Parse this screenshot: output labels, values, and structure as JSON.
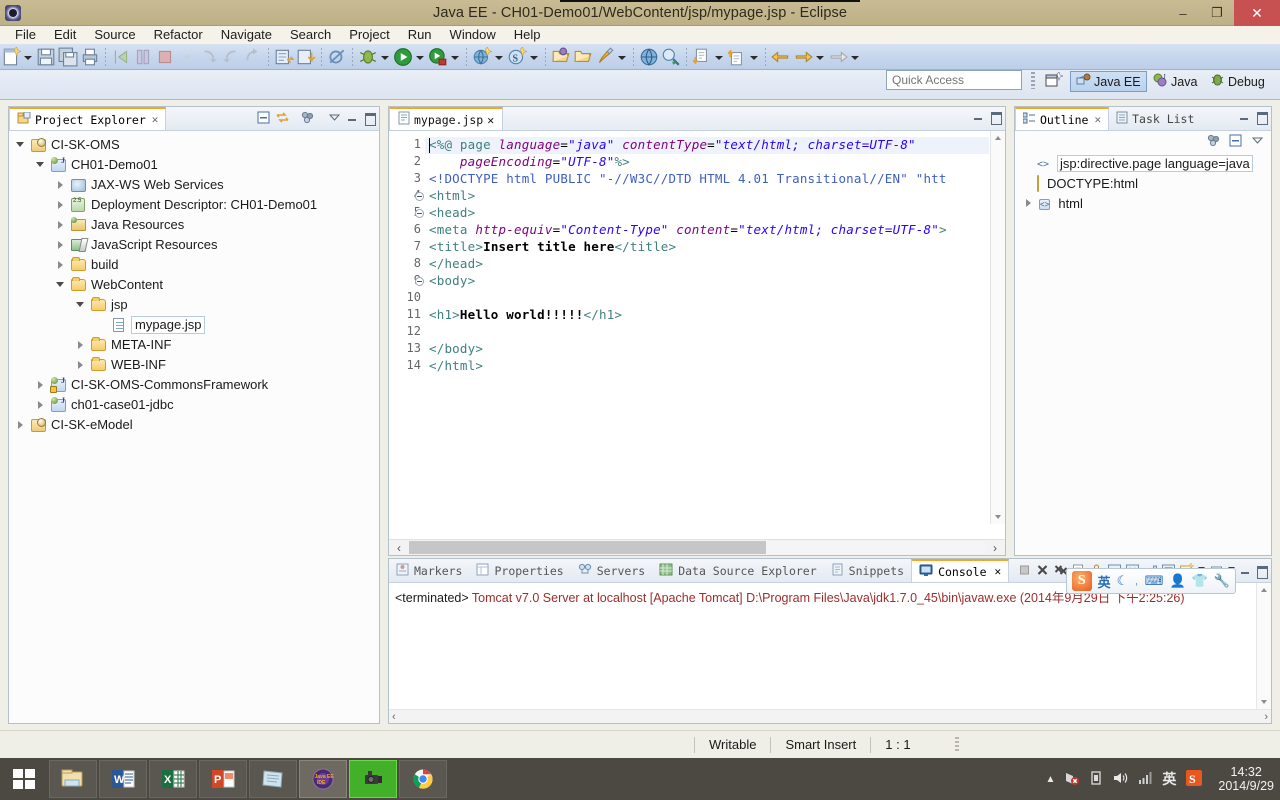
{
  "window": {
    "title": "Java EE - CH01-Demo01/WebContent/jsp/mypage.jsp - Eclipse",
    "minimize": "–",
    "maximize": "❐",
    "close": "✕"
  },
  "menubar": {
    "items": [
      "File",
      "Edit",
      "Source",
      "Refactor",
      "Navigate",
      "Search",
      "Project",
      "Run",
      "Window",
      "Help"
    ]
  },
  "toolbar": {
    "groups": [
      {
        "icons": [
          "new-wizard-icon",
          "new-dropdown-arrow",
          "save-icon",
          "save-all-icon",
          "print-icon"
        ]
      },
      {
        "icons": [
          "resume-icon",
          "suspend-icon",
          "terminate-icon",
          "step-icon",
          "step-into-icon",
          "step-over-icon",
          "step-return-icon"
        ]
      },
      {
        "icons": [
          "new-jsp-icon",
          "import-icon"
        ]
      },
      {
        "icons": [
          "skip-breakpoints-icon"
        ]
      },
      {
        "icons": [
          "debug-icon",
          "debug-dropdown-arrow",
          "run-icon",
          "run-dropdown-arrow",
          "run-external-icon",
          "external-dropdown-arrow"
        ]
      },
      {
        "icons": [
          "new-server-icon",
          "server-dropdown-arrow",
          "new-session-icon",
          "session-dropdown-arrow"
        ]
      },
      {
        "icons": [
          "open-type-icon",
          "open-task-icon",
          "brush-icon",
          "brush-dropdown-arrow"
        ]
      },
      {
        "icons": [
          "web-browser-icon",
          "search-icon"
        ]
      },
      {
        "icons": [
          "next-annotation-icon",
          "next-dropdown-arrow",
          "previous-annotation-icon",
          "previous-dropdown-arrow"
        ]
      },
      {
        "icons": [
          "back-icon",
          "forward-icon",
          "forward-dropdown-arrow",
          "last-edit-icon",
          "last-dropdown-arrow"
        ]
      }
    ]
  },
  "quick_access": {
    "placeholder": "Quick Access",
    "value": ""
  },
  "perspectives": {
    "open_perspective_icon": "open-perspective-icon",
    "items": [
      {
        "label": "Java EE",
        "icon": "java-ee-icon",
        "active": true
      },
      {
        "label": "Java",
        "icon": "java-icon",
        "active": false
      },
      {
        "label": "Debug",
        "icon": "debug-perspective-icon",
        "active": false
      }
    ]
  },
  "project_explorer": {
    "tab_label": "Project Explorer",
    "tab_close": "✕",
    "toolbar_icons": [
      "collapse-all-icon",
      "link-with-editor-icon",
      "view-menu-icon",
      "view-dropdown-icon",
      "minimize-icon",
      "maximize-icon"
    ],
    "tree": [
      {
        "label": "CI-SK-OMS",
        "depth": 0,
        "twist": "open",
        "icon": "project-icon",
        "selected": false
      },
      {
        "label": "CH01-Demo01",
        "depth": 1,
        "twist": "open",
        "icon": "web-project-icon",
        "selected": false
      },
      {
        "label": "JAX-WS Web Services",
        "depth": 2,
        "twist": "closed",
        "icon": "jax-ws-icon",
        "selected": false
      },
      {
        "label": "Deployment Descriptor: CH01-Demo01",
        "depth": 2,
        "twist": "closed",
        "icon": "deployment-descriptor-icon",
        "selected": false
      },
      {
        "label": "Java Resources",
        "depth": 2,
        "twist": "closed",
        "icon": "java-resources-icon",
        "selected": false
      },
      {
        "label": "JavaScript Resources",
        "depth": 2,
        "twist": "closed",
        "icon": "javascript-resources-icon",
        "selected": false
      },
      {
        "label": "build",
        "depth": 2,
        "twist": "closed",
        "icon": "folder-icon",
        "selected": false
      },
      {
        "label": "WebContent",
        "depth": 2,
        "twist": "open",
        "icon": "folder-icon",
        "selected": false
      },
      {
        "label": "jsp",
        "depth": 3,
        "twist": "open",
        "icon": "folder-icon",
        "selected": false
      },
      {
        "label": "mypage.jsp",
        "depth": 4,
        "twist": "none",
        "icon": "jsp-file-icon",
        "selected": true
      },
      {
        "label": "META-INF",
        "depth": 3,
        "twist": "closed",
        "icon": "folder-icon",
        "selected": false
      },
      {
        "label": "WEB-INF",
        "depth": 3,
        "twist": "closed",
        "icon": "folder-icon",
        "selected": false
      },
      {
        "label": "CI-SK-OMS-CommonsFramework",
        "depth": 1,
        "twist": "closed",
        "icon": "web-project-warning-icon",
        "selected": false
      },
      {
        "label": "ch01-case01-jdbc",
        "depth": 1,
        "twist": "closed",
        "icon": "web-project-icon",
        "selected": false
      },
      {
        "label": "CI-SK-eModel",
        "depth": 0,
        "twist": "closed",
        "icon": "project-icon",
        "selected": false
      }
    ]
  },
  "editor": {
    "tab_label": "mypage.jsp",
    "tab_icon": "jsp-file-icon",
    "tab_close": "✕",
    "minimize_icon": "minimize-icon",
    "maximize_icon": "maximize-icon",
    "cursor_line": 1,
    "lines": [
      {
        "n": 1,
        "fold": false,
        "highlight": true,
        "segments": [
          {
            "t": "<%@ ",
            "c": "dir"
          },
          {
            "t": "page ",
            "c": "dir"
          },
          {
            "t": "language",
            "c": "attr"
          },
          {
            "t": "=",
            "c": "punct"
          },
          {
            "t": "\"java\"",
            "c": "val"
          },
          {
            "t": " ",
            "c": "punct"
          },
          {
            "t": "contentType",
            "c": "attr"
          },
          {
            "t": "=",
            "c": "punct"
          },
          {
            "t": "\"text/html; charset=UTF-8\"",
            "c": "val"
          }
        ]
      },
      {
        "n": 2,
        "fold": false,
        "highlight": false,
        "segments": [
          {
            "t": "    ",
            "c": "punct"
          },
          {
            "t": "pageEncoding",
            "c": "attr"
          },
          {
            "t": "=",
            "c": "punct"
          },
          {
            "t": "\"UTF-8\"",
            "c": "val"
          },
          {
            "t": "%>",
            "c": "dir"
          }
        ]
      },
      {
        "n": 3,
        "fold": false,
        "highlight": false,
        "segments": [
          {
            "t": "<!DOCTYPE html PUBLIC \"-//W3C//DTD HTML 4.01 Transitional//EN\" \"htt",
            "c": "dtd"
          }
        ]
      },
      {
        "n": 4,
        "fold": true,
        "highlight": false,
        "segments": [
          {
            "t": "<html>",
            "c": "tag"
          }
        ]
      },
      {
        "n": 5,
        "fold": true,
        "highlight": false,
        "segments": [
          {
            "t": "<head>",
            "c": "tag"
          }
        ]
      },
      {
        "n": 6,
        "fold": false,
        "highlight": false,
        "segments": [
          {
            "t": "<meta ",
            "c": "tag"
          },
          {
            "t": "http-equiv",
            "c": "attr"
          },
          {
            "t": "=",
            "c": "punct"
          },
          {
            "t": "\"Content-Type\"",
            "c": "val"
          },
          {
            "t": " ",
            "c": "punct"
          },
          {
            "t": "content",
            "c": "attr"
          },
          {
            "t": "=",
            "c": "punct"
          },
          {
            "t": "\"text/html; charset=UTF-8\"",
            "c": "val"
          },
          {
            "t": ">",
            "c": "tag"
          }
        ]
      },
      {
        "n": 7,
        "fold": false,
        "highlight": false,
        "segments": [
          {
            "t": "<title>",
            "c": "tag"
          },
          {
            "t": "Insert title here",
            "c": "txt"
          },
          {
            "t": "</title>",
            "c": "tag"
          }
        ]
      },
      {
        "n": 8,
        "fold": false,
        "highlight": false,
        "segments": [
          {
            "t": "</head>",
            "c": "tag"
          }
        ]
      },
      {
        "n": 9,
        "fold": true,
        "highlight": false,
        "segments": [
          {
            "t": "<body>",
            "c": "tag"
          }
        ]
      },
      {
        "n": 10,
        "fold": false,
        "highlight": false,
        "segments": []
      },
      {
        "n": 11,
        "fold": false,
        "highlight": false,
        "segments": [
          {
            "t": "<h1>",
            "c": "tag"
          },
          {
            "t": "Hello world!!!!!",
            "c": "txt"
          },
          {
            "t": "</h1>",
            "c": "tag"
          }
        ]
      },
      {
        "n": 12,
        "fold": false,
        "highlight": false,
        "segments": []
      },
      {
        "n": 13,
        "fold": false,
        "highlight": false,
        "segments": [
          {
            "t": "</body>",
            "c": "tag"
          }
        ]
      },
      {
        "n": 14,
        "fold": false,
        "highlight": false,
        "segments": [
          {
            "t": "</html>",
            "c": "tag"
          }
        ]
      }
    ],
    "hscroll_left": "‹",
    "hscroll_right": "›"
  },
  "outline": {
    "tabs": [
      {
        "label": "Outline",
        "icon": "outline-icon",
        "active": true,
        "close": "✕"
      },
      {
        "label": "Task List",
        "icon": "task-list-icon",
        "active": false
      }
    ],
    "toolbar_icons": [
      "sort-icon",
      "collapse-all-icon",
      "view-menu-icon"
    ],
    "minimize_icon": "minimize-icon",
    "maximize_icon": "maximize-icon",
    "items": [
      {
        "label": "jsp:directive.page language=java",
        "icon": "jsp-directive-icon",
        "depth": 1,
        "twist": "none",
        "selected": true
      },
      {
        "label": "DOCTYPE:html",
        "icon": "doctype-icon",
        "depth": 1,
        "twist": "none",
        "selected": false
      },
      {
        "label": "html",
        "icon": "html-element-icon",
        "depth": 1,
        "twist": "closed",
        "selected": false
      }
    ]
  },
  "console": {
    "tabs": [
      {
        "label": "Markers",
        "icon": "markers-icon",
        "active": false
      },
      {
        "label": "Properties",
        "icon": "properties-icon",
        "active": false
      },
      {
        "label": "Servers",
        "icon": "servers-icon",
        "active": false
      },
      {
        "label": "Data Source Explorer",
        "icon": "data-source-explorer-icon",
        "active": false
      },
      {
        "label": "Snippets",
        "icon": "snippets-icon",
        "active": false
      },
      {
        "label": "Console",
        "icon": "console-icon",
        "active": true,
        "close": "✕"
      }
    ],
    "toolbar_icons": [
      "terminate-icon",
      "remove-launch-icon",
      "remove-all-terminated-icon",
      "print-console-icon",
      "lock-scroll-icon",
      "clear-console-icon",
      "scroll-lock-icon",
      "show-console-icon",
      "pin-console-icon",
      "display-selected-console-icon",
      "display-dropdown-icon",
      "open-console-icon",
      "open-dropdown-icon",
      "minimize-icon",
      "maximize-icon"
    ],
    "output": {
      "prefix": "<terminated>",
      "text": " Tomcat v7.0 Server at localhost [Apache Tomcat] D:\\Program Files\\Java\\jdk1.7.0_45\\bin\\javaw.exe (2014年9月29日 下午2:25:26)"
    },
    "hscroll_left": "‹",
    "hscroll_right": "›"
  },
  "ime": {
    "logo": "S",
    "icons": [
      "chinese-english-toggle",
      "moon-icon",
      "punctuation-icon",
      "keyboard-icon",
      "user-icon",
      "skin-icon",
      "toolbox-icon"
    ],
    "lang_label": "英"
  },
  "statusbar": {
    "writable": "Writable",
    "insert_mode": "Smart Insert",
    "position": "1 : 1"
  },
  "taskbar": {
    "start": "windows-start-icon",
    "apps": [
      {
        "name": "file-explorer-icon",
        "label": "",
        "state": "normal"
      },
      {
        "name": "word-icon",
        "label": "W",
        "state": "normal"
      },
      {
        "name": "excel-icon",
        "label": "X",
        "state": "normal"
      },
      {
        "name": "powerpoint-icon",
        "label": "P",
        "state": "normal"
      },
      {
        "name": "notepad-icon",
        "label": "",
        "state": "normal"
      },
      {
        "name": "eclipse-icon",
        "label": "",
        "state": "active"
      },
      {
        "name": "camera-app-icon",
        "label": "",
        "state": "green"
      },
      {
        "name": "chrome-icon",
        "label": "",
        "state": "normal"
      }
    ],
    "tray": {
      "show_hidden": "▲",
      "icons": [
        "network-error-icon",
        "usb-icon",
        "volume-icon",
        "signal-icon"
      ],
      "ime_lang": "英",
      "sogou": "S",
      "time": "14:32",
      "date": "2014/9/29"
    }
  }
}
